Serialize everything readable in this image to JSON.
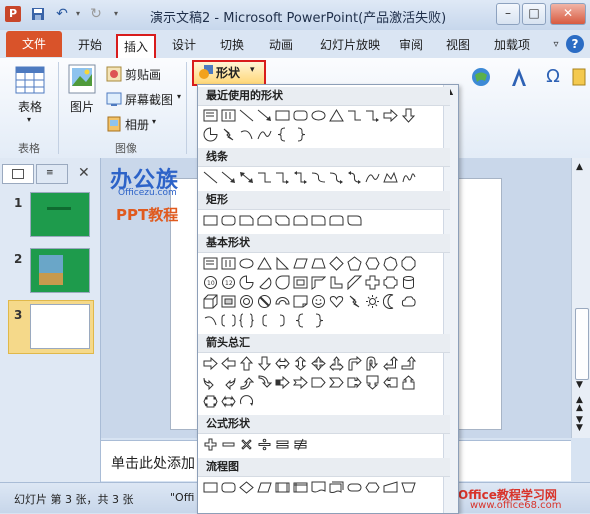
{
  "window": {
    "title": "演示文稿2 - Microsoft PowerPoint(产品激活失败)"
  },
  "tabs": [
    "文件",
    "开始",
    "插入",
    "设计",
    "切换",
    "动画",
    "幻灯片放映",
    "审阅",
    "视图",
    "加载项"
  ],
  "ribbon": {
    "table_label": "表格",
    "image_label": "图片",
    "clipart_label": "剪贴画",
    "screenshot_label": "屏幕截图",
    "album_label": "相册",
    "group_table": "表格",
    "group_image": "图像",
    "shapes_label": "形状"
  },
  "gallery": {
    "recent": "最近使用的形状",
    "lines": "线条",
    "rect": "矩形",
    "basic": "基本形状",
    "arrows": "箭头总汇",
    "equation": "公式形状",
    "flowchart": "流程图"
  },
  "slides": {
    "n1": "1",
    "n2": "2",
    "n3": "3"
  },
  "watermark": {
    "brand": "办公族",
    "site": "Officezu.com",
    "ppt": "PPT教程"
  },
  "notes_placeholder": "单击此处添加",
  "status": {
    "slide_info": "幻灯片 第 3 张，共 3 张",
    "theme": "\"Offi"
  },
  "footer_brand": "Office教程学习网",
  "footer_url": "www.office68.com",
  "colors": {
    "file_tab": "#d9532a",
    "highlight": "#d81c1c",
    "slide_green": "#1e9b4c"
  }
}
